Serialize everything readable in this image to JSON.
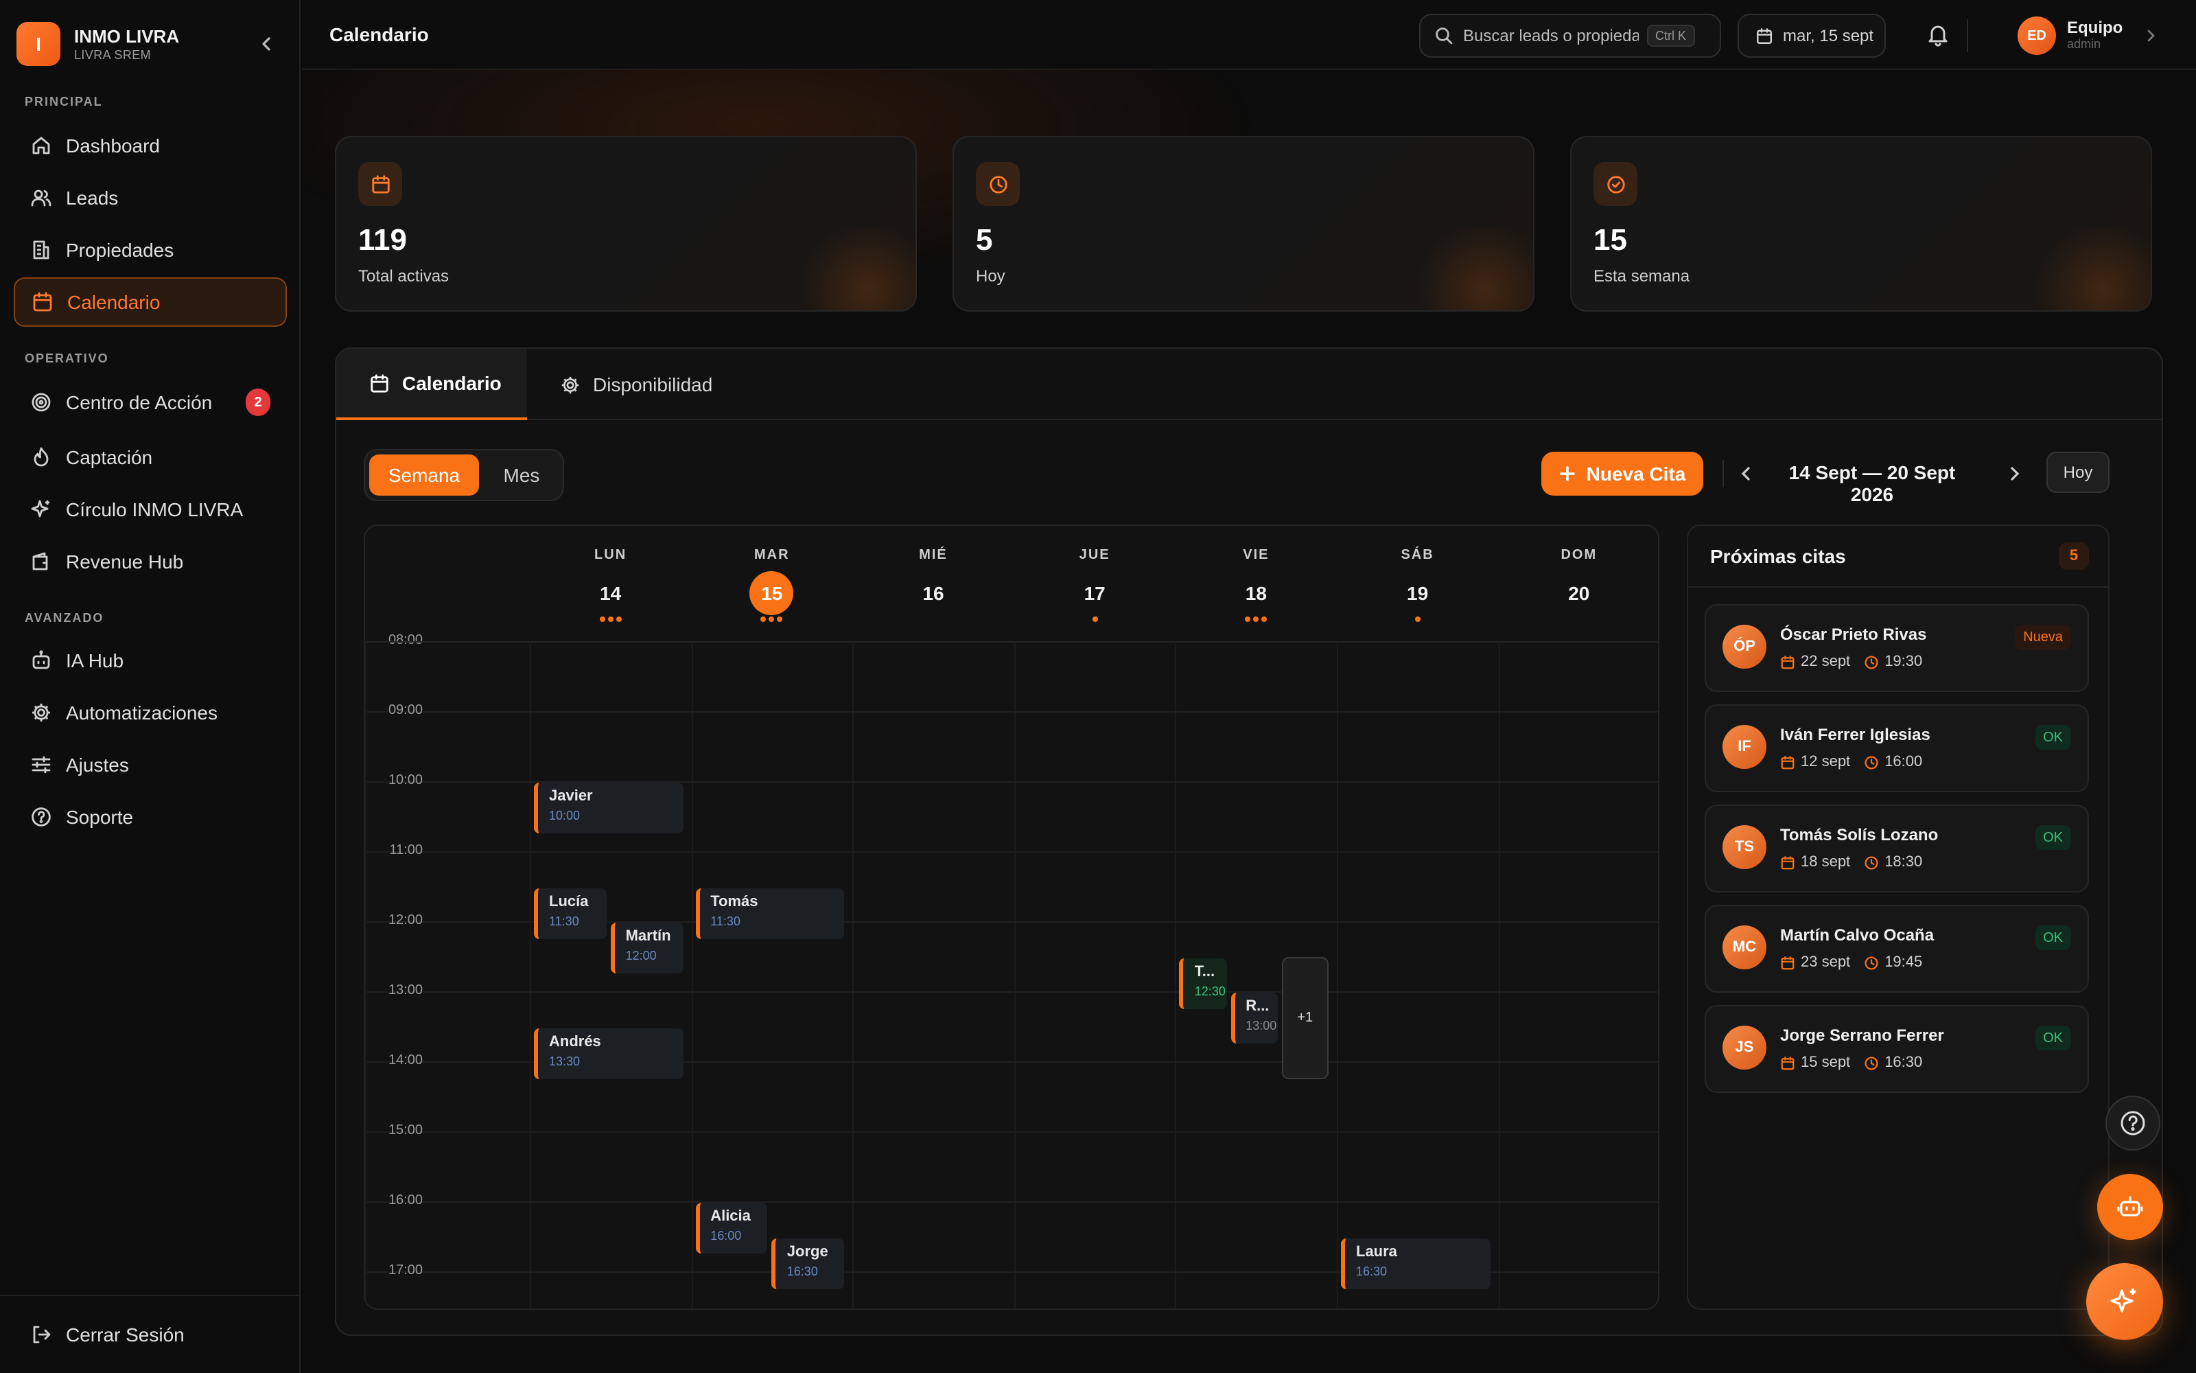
{
  "brand": {
    "logo_letter": "I",
    "name": "INMO LIVRA",
    "subtitle": "LIVRA SREM"
  },
  "sidebar": {
    "sections": [
      "PRINCIPAL",
      "OPERATIVO",
      "AVANZADO"
    ],
    "items": [
      {
        "label": "Dashboard",
        "icon": "home-icon"
      },
      {
        "label": "Leads",
        "icon": "users-icon"
      },
      {
        "label": "Propiedades",
        "icon": "building-icon"
      },
      {
        "label": "Calendario",
        "icon": "calendar-icon",
        "active": true
      },
      {
        "label": "Centro de Acción",
        "icon": "target-icon",
        "badge": "2"
      },
      {
        "label": "Captación",
        "icon": "flame-icon"
      },
      {
        "label": "Círculo INMO LIVRA",
        "icon": "sparkles-icon"
      },
      {
        "label": "Revenue Hub",
        "icon": "wallet-icon"
      },
      {
        "label": "IA Hub",
        "icon": "bot-icon"
      },
      {
        "label": "Automatizaciones",
        "icon": "gear-icon"
      },
      {
        "label": "Ajustes",
        "icon": "sliders-icon"
      },
      {
        "label": "Soporte",
        "icon": "help-circle-icon"
      }
    ],
    "logout": "Cerrar Sesión"
  },
  "topbar": {
    "title": "Calendario",
    "search_placeholder": "Buscar leads o propiedades...",
    "search_shortcut": "Ctrl K",
    "date": "mar, 15 sept",
    "user_initials": "ED",
    "user_name": "Equipo",
    "user_role": "admin"
  },
  "stats": [
    {
      "value": "119",
      "label": "Total activas",
      "icon": "calendar-icon"
    },
    {
      "value": "5",
      "label": "Hoy",
      "icon": "clock-icon"
    },
    {
      "value": "15",
      "label": "Esta semana",
      "icon": "check-circle-icon"
    }
  ],
  "tabs": [
    {
      "label": "Calendario",
      "icon": "calendar-icon",
      "active": true
    },
    {
      "label": "Disponibilidad",
      "icon": "gear-icon"
    }
  ],
  "toolbar": {
    "view_week": "Semana",
    "view_month": "Mes",
    "new_button": "Nueva Cita",
    "range": "14 Sept — 20 Sept 2026",
    "today_button": "Hoy"
  },
  "calendar": {
    "days": [
      {
        "name": "LUN",
        "num": "14",
        "dots": 3
      },
      {
        "name": "MAR",
        "num": "15",
        "dots": 3,
        "today": true
      },
      {
        "name": "MIÉ",
        "num": "16",
        "dots": 0
      },
      {
        "name": "JUE",
        "num": "17",
        "dots": 1
      },
      {
        "name": "VIE",
        "num": "18",
        "dots": 3
      },
      {
        "name": "SÁB",
        "num": "19",
        "dots": 1
      },
      {
        "name": "DOM",
        "num": "20",
        "dots": 0
      }
    ],
    "hours": [
      "08:00",
      "09:00",
      "10:00",
      "11:00",
      "12:00",
      "13:00",
      "14:00",
      "15:00",
      "16:00",
      "17:00"
    ],
    "events": [
      {
        "name": "Javier",
        "time": "10:00",
        "day": 0,
        "start": 10.0,
        "lane": 0,
        "lanes": 1
      },
      {
        "name": "Lucía",
        "time": "11:30",
        "day": 0,
        "start": 11.5,
        "lane": 0,
        "lanes": 2
      },
      {
        "name": "Martín",
        "time": "12:00",
        "day": 0,
        "start": 12.0,
        "lane": 1,
        "lanes": 2
      },
      {
        "name": "Andrés",
        "time": "13:30",
        "day": 0,
        "start": 13.5,
        "lane": 0,
        "lanes": 1
      },
      {
        "name": "Tomás",
        "time": "11:30",
        "day": 1,
        "start": 11.5,
        "lane": 0,
        "lanes": 1
      },
      {
        "name": "Alicia",
        "time": "16:00",
        "day": 1,
        "start": 16.0,
        "lane": 0,
        "lanes": 2
      },
      {
        "name": "Jorge",
        "time": "16:30",
        "day": 1,
        "start": 16.5,
        "lane": 1,
        "lanes": 2
      },
      {
        "name": "T...",
        "time": "12:30",
        "day": 4,
        "start": 12.5,
        "lane": 0,
        "lanes": 3,
        "style": "green"
      },
      {
        "name": "R...",
        "time": "13:00",
        "day": 4,
        "start": 13.0,
        "lane": 1,
        "lanes": 3,
        "style": "gray"
      },
      {
        "name": "Laura",
        "time": "16:30",
        "day": 5,
        "start": 16.5,
        "lane": 0,
        "lanes": 1
      }
    ],
    "more": {
      "label": "+1",
      "day": 4,
      "start": 12.5,
      "end": 14.25,
      "lane": 2,
      "lanes": 3
    }
  },
  "upcoming": {
    "title": "Próximas citas",
    "count": "5",
    "items": [
      {
        "initials": "ÓP",
        "name": "Óscar Prieto Rivas",
        "date": "22 sept",
        "time": "19:30",
        "status": "Nueva",
        "status_type": "new"
      },
      {
        "initials": "IF",
        "name": "Iván Ferrer Iglesias",
        "date": "12 sept",
        "time": "16:00",
        "status": "OK",
        "status_type": "ok"
      },
      {
        "initials": "TS",
        "name": "Tomás Solís Lozano",
        "date": "18 sept",
        "time": "18:30",
        "status": "OK",
        "status_type": "ok"
      },
      {
        "initials": "MC",
        "name": "Martín Calvo Ocaña",
        "date": "23 sept",
        "time": "19:45",
        "status": "OK",
        "status_type": "ok"
      },
      {
        "initials": "JS",
        "name": "Jorge Serrano Ferrer",
        "date": "15 sept",
        "time": "16:30",
        "status": "OK",
        "status_type": "ok"
      }
    ]
  },
  "colors": {
    "accent": "#f97316",
    "danger": "#e5383b",
    "success": "#3dbf78"
  }
}
